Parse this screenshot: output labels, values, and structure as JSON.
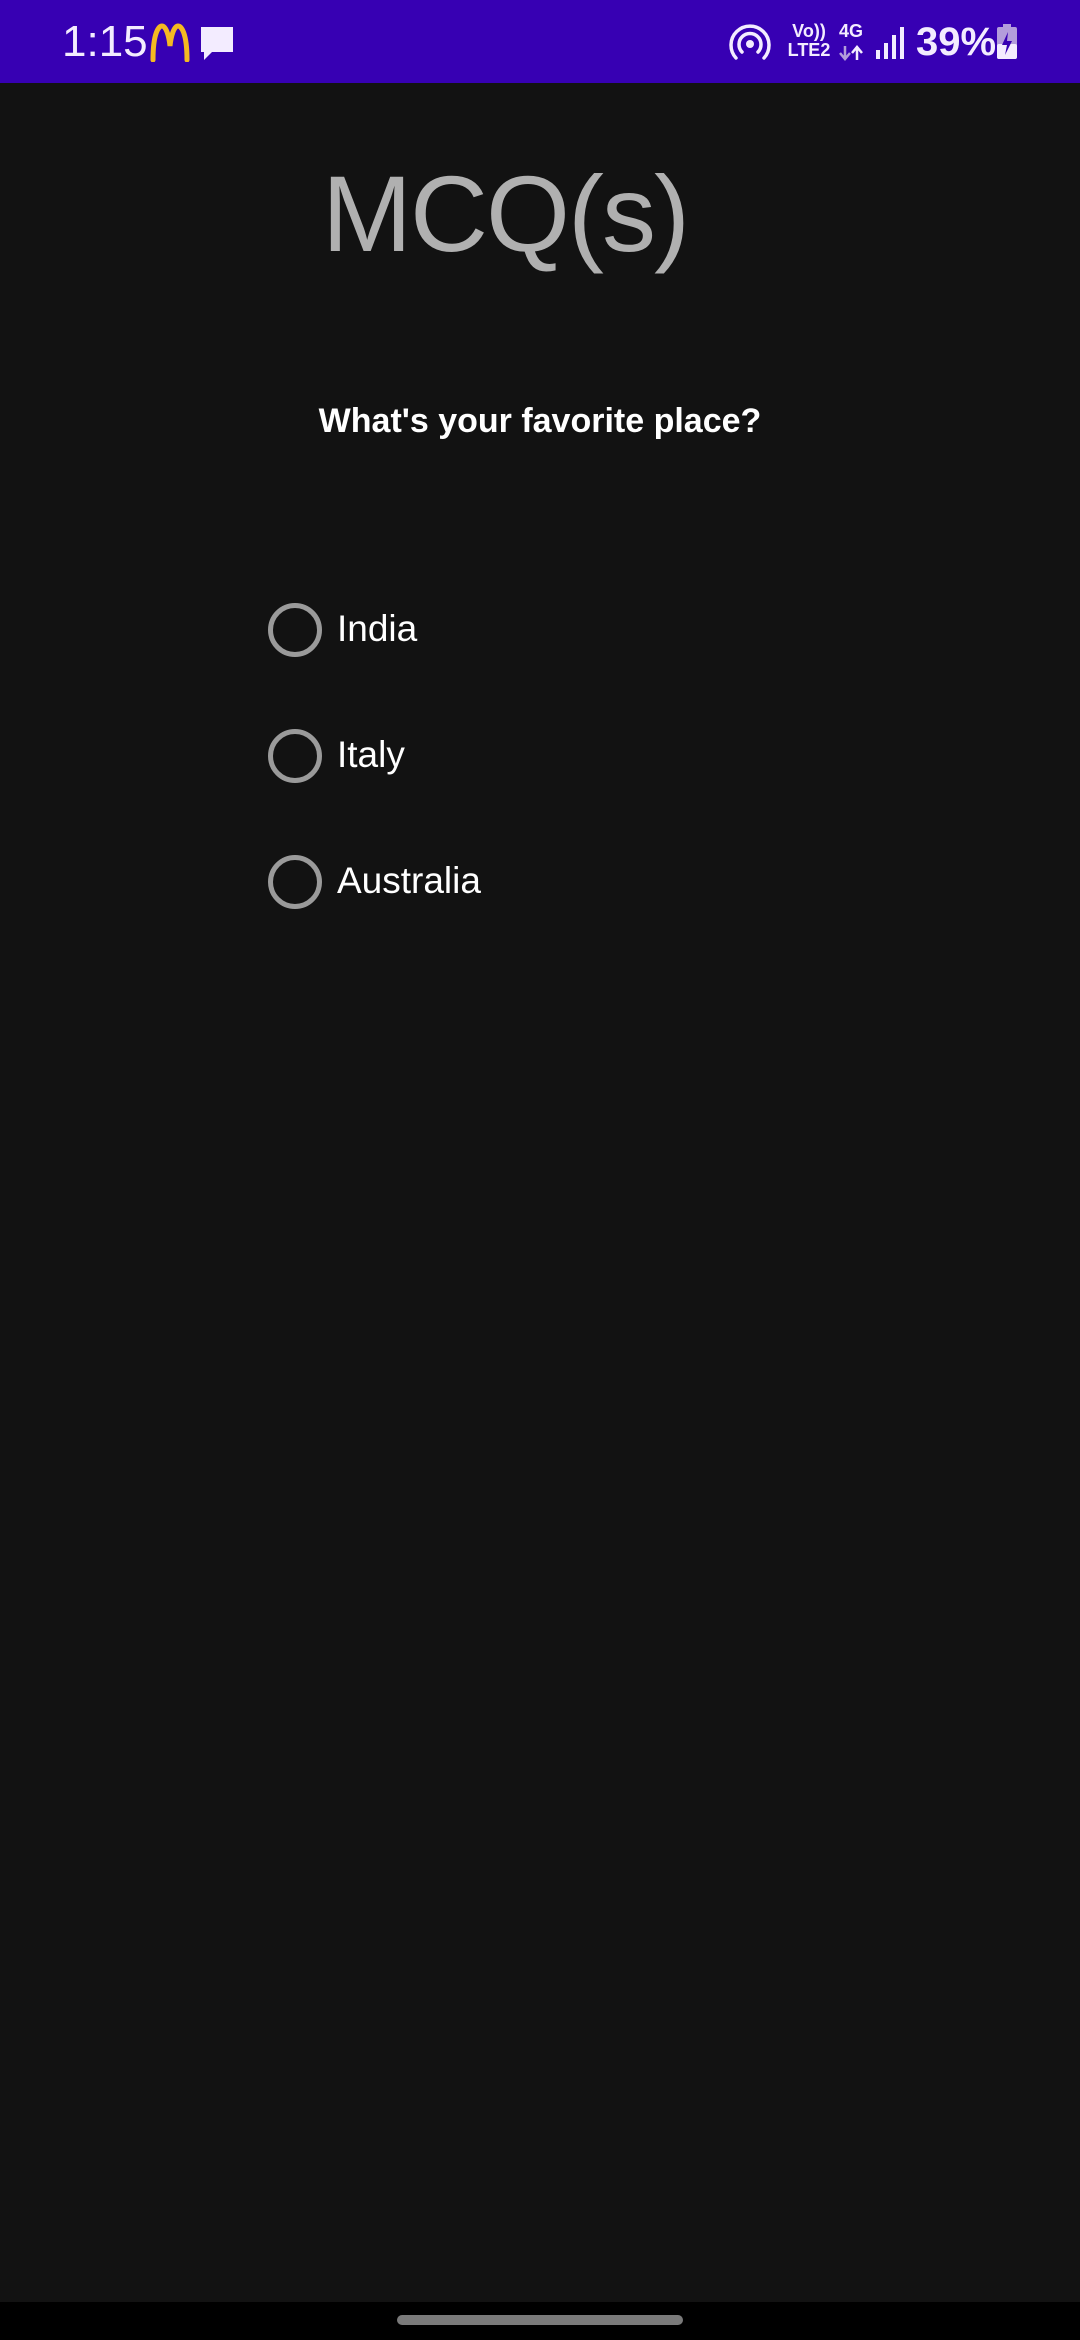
{
  "status_bar": {
    "time": "1:15",
    "volte_line1": "Vo))",
    "volte_line2": "LTE2",
    "network": "4G",
    "battery": "39%",
    "icons": [
      "mcdonalds-icon",
      "chat-icon",
      "hotspot-icon",
      "signal-icon",
      "battery-charging-icon"
    ],
    "background_color": "#3700b3"
  },
  "screen": {
    "title": "MCQ(s)",
    "question": "What's your favorite place?",
    "options": [
      {
        "label": "India",
        "selected": false
      },
      {
        "label": "Italy",
        "selected": false
      },
      {
        "label": "Australia",
        "selected": false
      }
    ],
    "background_color": "#121212",
    "title_color": "#b0b0b0"
  }
}
